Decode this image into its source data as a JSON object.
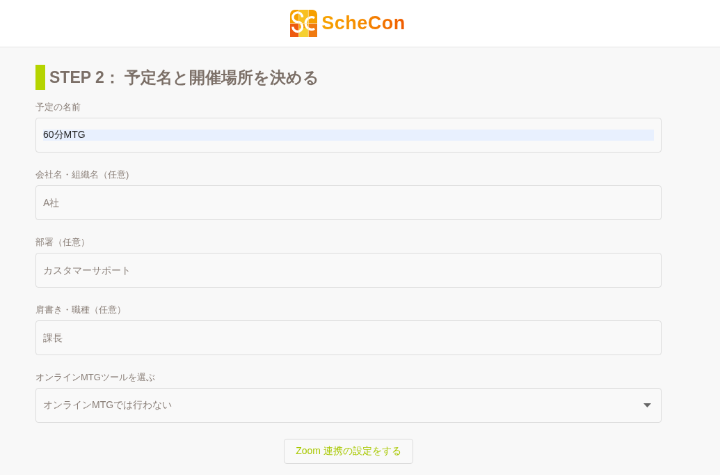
{
  "header": {
    "brand": "ScheCon"
  },
  "step": {
    "title": "STEP 2： 予定名と開催場所を決める"
  },
  "fields": [
    {
      "kind": "text",
      "label": "予定の名前",
      "value": "60分MTG",
      "highlighted": true
    },
    {
      "kind": "text",
      "label": "会社名・組織名（任意)",
      "placeholder": "A社",
      "highlighted": false
    },
    {
      "kind": "text",
      "label": "部署（任意）",
      "placeholder": "カスタマーサポート",
      "highlighted": false
    },
    {
      "kind": "text",
      "label": "肩書き・職種（任意）",
      "placeholder": "課長",
      "highlighted": false
    },
    {
      "kind": "select",
      "label": "オンラインMTGツールを選ぶ",
      "value": "オンラインMTGでは行わない",
      "highlighted": false
    }
  ],
  "zoom_button": {
    "label": "Zoom 連携の設定をする"
  }
}
